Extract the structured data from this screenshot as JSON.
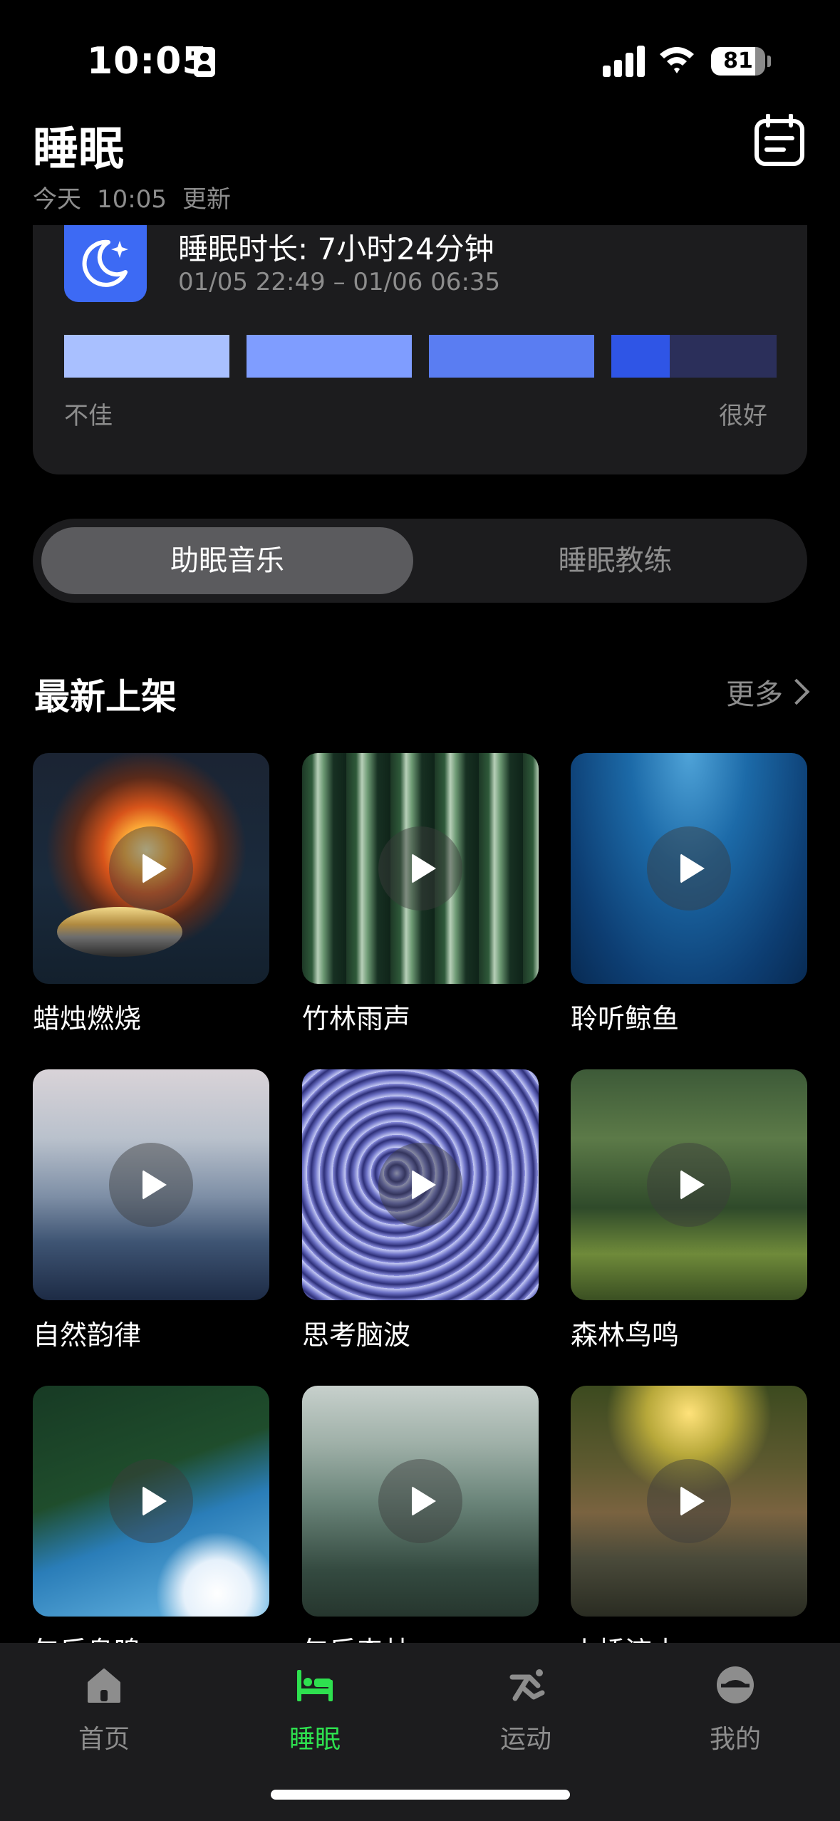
{
  "status_bar": {
    "time": "10:05",
    "battery": "81",
    "battery_level": 0.81,
    "icons": [
      "id-card-icon",
      "signal-icon",
      "wifi-icon",
      "battery-icon"
    ]
  },
  "header": {
    "title": "睡眠",
    "update_day": "今天",
    "update_time": "10:05",
    "update_label": "更新",
    "calendar_icon": "calendar-icon"
  },
  "sleep_card": {
    "duration": "睡眠时长: 7小时24分钟",
    "range": "01/05 22:49  –  01/06 06:35",
    "scale_low": "不佳",
    "scale_high": "很好",
    "quality_level": 0.85,
    "segment_colors": [
      "#a9c0ff",
      "#7f9dff",
      "#5a7df2",
      "#2f55e6",
      "#2b2f5a"
    ]
  },
  "tabs": [
    {
      "label": "助眠音乐",
      "active": true
    },
    {
      "label": "睡眠教练",
      "active": false
    }
  ],
  "section": {
    "title": "最新上架",
    "more": "更多"
  },
  "items": [
    {
      "label": "蜡烛燃烧"
    },
    {
      "label": "竹林雨声"
    },
    {
      "label": "聆听鲸鱼"
    },
    {
      "label": "自然韵律"
    },
    {
      "label": "思考脑波"
    },
    {
      "label": "森林鸟鸣"
    },
    {
      "label": "午后鸟鸣"
    },
    {
      "label": "午后森林"
    },
    {
      "label": "小桥流水"
    }
  ],
  "bottom_nav": [
    {
      "label": "首页",
      "icon": "home-icon",
      "active": false
    },
    {
      "label": "睡眠",
      "icon": "bed-icon",
      "active": true
    },
    {
      "label": "运动",
      "icon": "running-icon",
      "active": false
    },
    {
      "label": "我的",
      "icon": "profile-icon",
      "active": false
    }
  ],
  "colors": {
    "accent_green": "#2ee04f",
    "accent_blue": "#3d6af4",
    "card_bg": "#1c1c1e"
  }
}
